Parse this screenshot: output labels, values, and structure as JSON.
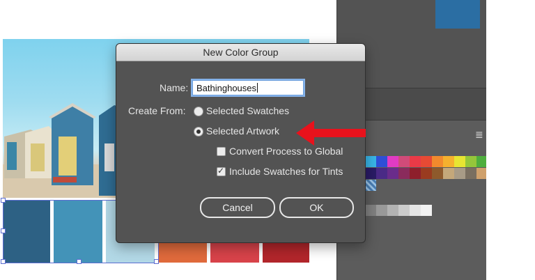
{
  "dialog": {
    "title": "New Color Group",
    "name_label": "Name:",
    "name_value": "Bathinghouses",
    "create_from_label": "Create From:",
    "options": {
      "selected_swatches": "Selected Swatches",
      "selected_artwork": "Selected Artwork",
      "selected": "selected_artwork"
    },
    "checkboxes": {
      "convert_process_to_global": {
        "label": "Convert Process to Global",
        "checked": false
      },
      "include_swatches_for_tints": {
        "label": "Include Swatches for Tints",
        "checked": true
      }
    },
    "buttons": {
      "cancel": "Cancel",
      "ok": "OK"
    }
  },
  "colors": {
    "dialog_bg": "#535353",
    "panel_bg": "#5c5c5c",
    "annotation_arrow": "#e8121c",
    "artwork_swatches": [
      "#2d6184",
      "#4393b8",
      "#b2d8e6",
      "#e06a3c",
      "#d8434a",
      "#b2262b"
    ],
    "panel_swatch_row1": [
      "#39b6e8",
      "#2f4fd6",
      "#e13bc3",
      "#d14b79",
      "#ea3a47",
      "#e74a34",
      "#f28a2d",
      "#f5b12e",
      "#e7e532",
      "#95c63a"
    ],
    "panel_swatch_row2": [
      "#2a1b66",
      "#4a2a86",
      "#6a2c8b",
      "#8a2b5c",
      "#8e1f2b",
      "#9a3b1f",
      "#8e5a2c",
      "#c4a87a",
      "#a89b86",
      "#7a6f60",
      "#d0a16c"
    ],
    "panel_gray_swatches": [
      "#808080",
      "#999999",
      "#b3b3b3",
      "#cccccc",
      "#e6e6e6",
      "#f2f2f2"
    ]
  },
  "icons": [
    "panel-menu-icon",
    "pattern-swatch-icon",
    "red-arrow-annotation"
  ]
}
